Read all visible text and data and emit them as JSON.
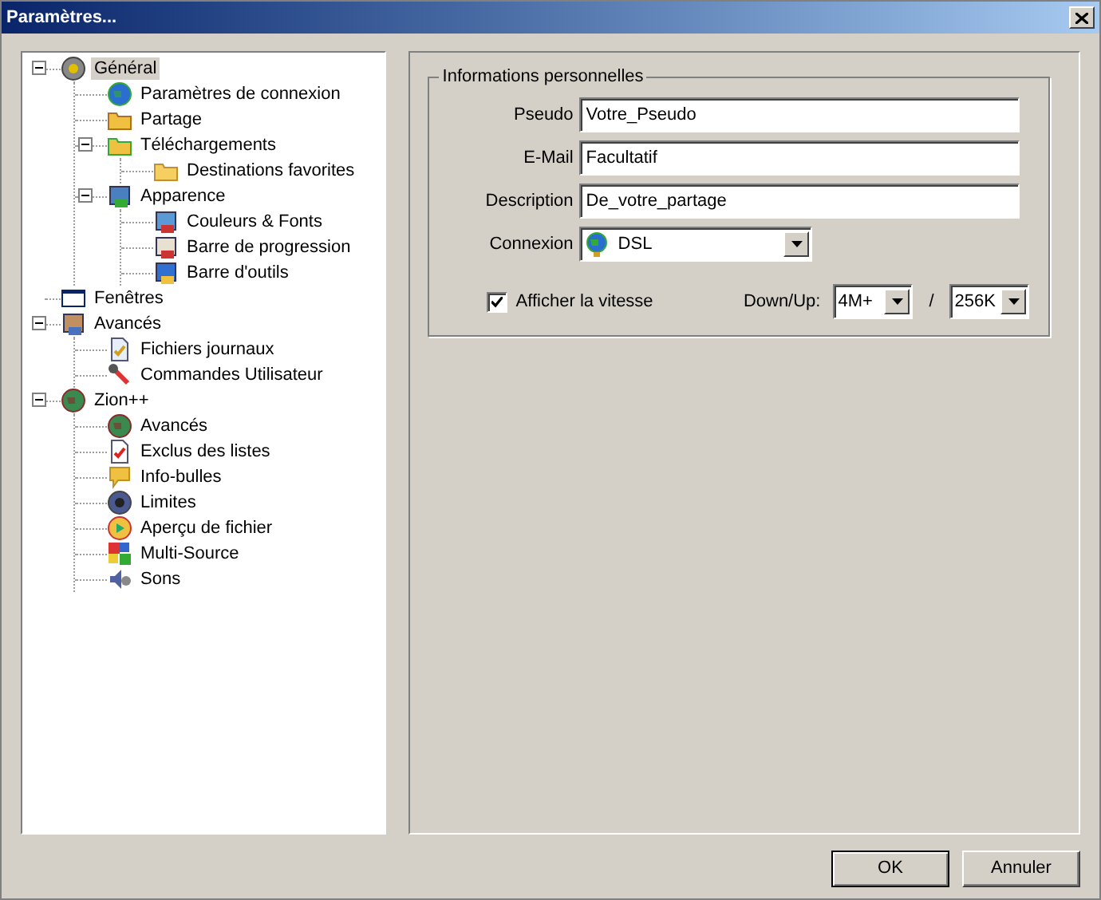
{
  "window": {
    "title": "Paramètres..."
  },
  "tree": [
    {
      "label": "Général",
      "selected": true,
      "expanded": true,
      "children": [
        {
          "label": "Paramètres de connexion",
          "selected": false
        },
        {
          "label": "Partage",
          "selected": false
        },
        {
          "label": "Téléchargements",
          "selected": false,
          "expanded": true,
          "children": [
            {
              "label": "Destinations favorites",
              "selected": false
            }
          ]
        },
        {
          "label": "Apparence",
          "selected": false,
          "expanded": true,
          "children": [
            {
              "label": "Couleurs & Fonts",
              "selected": false
            },
            {
              "label": "Barre de progression",
              "selected": false
            },
            {
              "label": "Barre d'outils",
              "selected": false
            }
          ]
        }
      ]
    },
    {
      "label": "Fenêtres",
      "selected": false
    },
    {
      "label": "Avancés",
      "selected": false,
      "expanded": true,
      "children": [
        {
          "label": "Fichiers journaux",
          "selected": false
        },
        {
          "label": "Commandes Utilisateur",
          "selected": false
        }
      ]
    },
    {
      "label": "Zion++",
      "selected": false,
      "expanded": true,
      "children": [
        {
          "label": "Avancés",
          "selected": false
        },
        {
          "label": "Exclus des listes",
          "selected": false
        },
        {
          "label": "Info-bulles",
          "selected": false
        },
        {
          "label": "Limites",
          "selected": false
        },
        {
          "label": "Aperçu de fichier",
          "selected": false
        },
        {
          "label": "Multi-Source",
          "selected": false
        },
        {
          "label": "Sons",
          "selected": false
        }
      ]
    }
  ],
  "group": {
    "title": "Informations personnelles",
    "fields": [
      {
        "label": "Pseudo",
        "value": "Votre_Pseudo"
      },
      {
        "label": "E-Mail",
        "value": "Facultatif"
      },
      {
        "label": "Description",
        "value": "De_votre_partage"
      }
    ],
    "connection": {
      "label": "Connexion",
      "value": "DSL"
    },
    "show_speed": {
      "label": "Afficher la vitesse",
      "checked": true
    },
    "speed": {
      "label": "Down/Up:",
      "down": "4M+",
      "separator": "/",
      "up": "256K"
    }
  },
  "buttons": [
    {
      "label": "OK",
      "default": true
    },
    {
      "label": "Annuler",
      "default": false
    }
  ]
}
